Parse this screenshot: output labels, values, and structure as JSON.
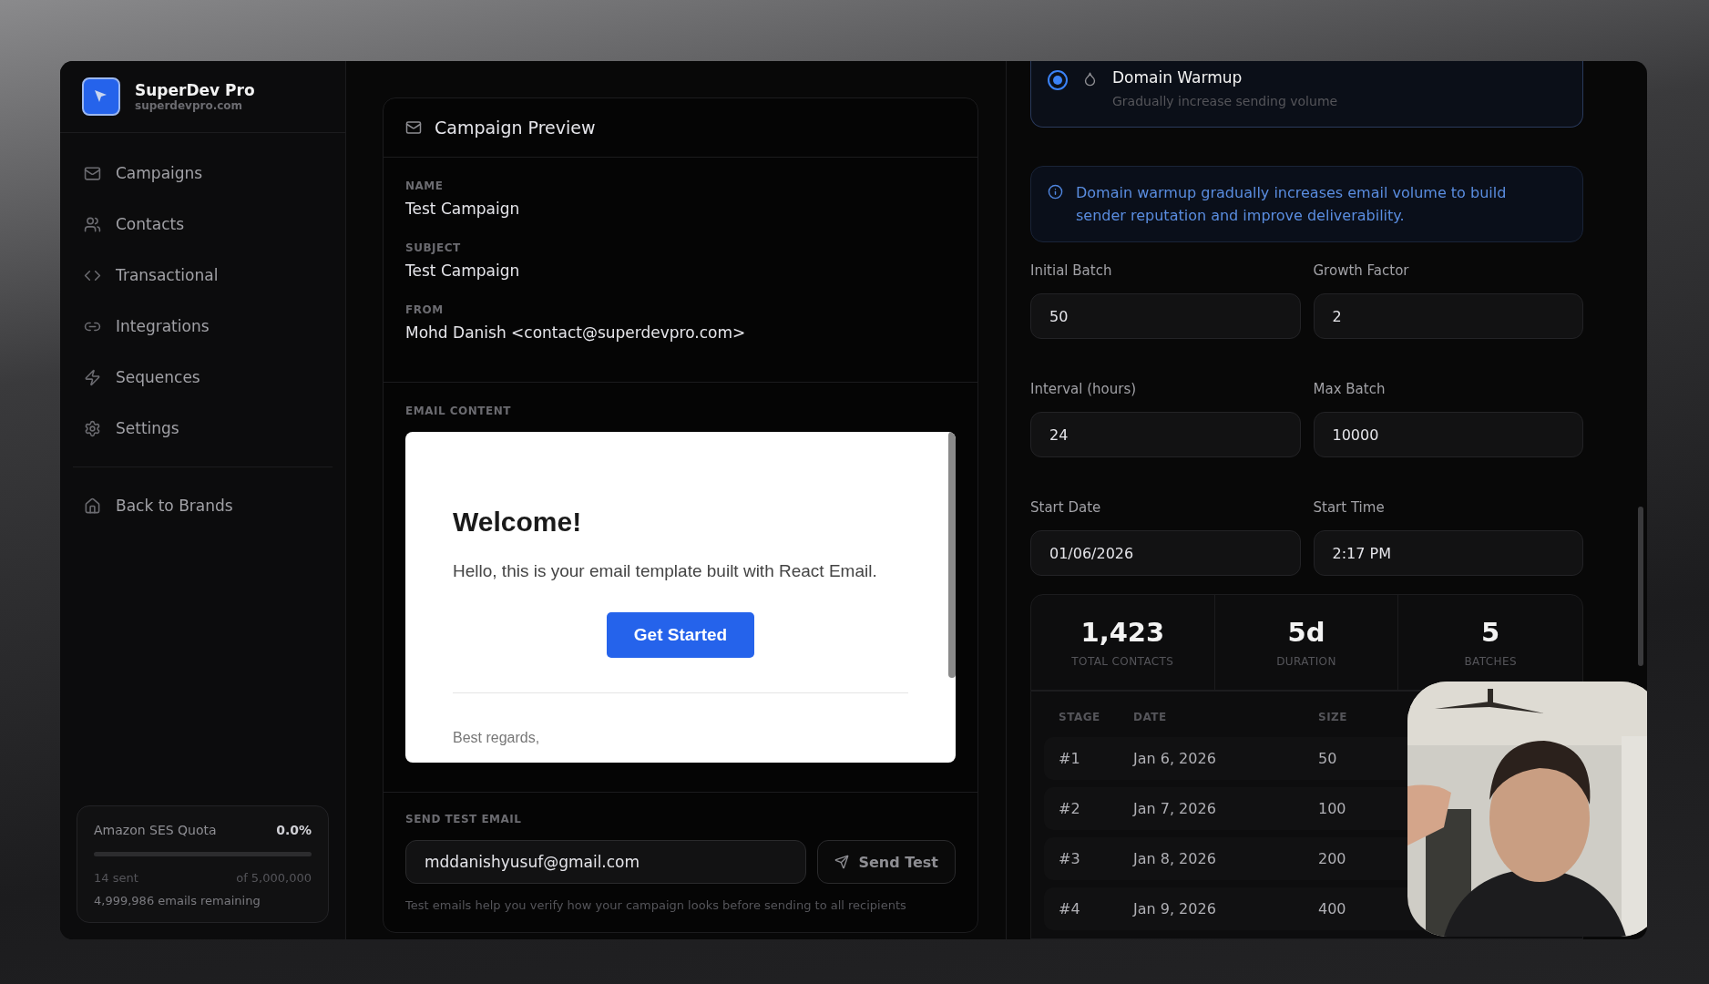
{
  "brand": {
    "name": "SuperDev Pro",
    "domain": "superdevpro.com"
  },
  "nav": [
    {
      "label": "Campaigns"
    },
    {
      "label": "Contacts"
    },
    {
      "label": "Transactional"
    },
    {
      "label": "Integrations"
    },
    {
      "label": "Sequences"
    },
    {
      "label": "Settings"
    }
  ],
  "back_link": "Back to Brands",
  "quota": {
    "title": "Amazon SES Quota",
    "percent": "0.0%",
    "level": 0,
    "sent": "14 sent",
    "total": "of 5,000,000",
    "remaining": "4,999,986 emails remaining"
  },
  "preview": {
    "title": "Campaign Preview",
    "fields": [
      {
        "label": "NAME",
        "value": "Test Campaign"
      },
      {
        "label": "SUBJECT",
        "value": "Test Campaign"
      },
      {
        "label": "FROM",
        "value": "Mohd Danish <contact@superdevpro.com>"
      }
    ],
    "content_label": "EMAIL CONTENT",
    "email": {
      "heading": "Welcome!",
      "body": "Hello, this is your email template built with React Email.",
      "button": "Get Started",
      "signoff": "Best regards,"
    },
    "send_label": "SEND TEST EMAIL",
    "send_value": "mddanishyusuf@gmail.com",
    "send_button": "Send Test",
    "send_hint": "Test emails help you verify how your campaign looks before sending to all recipients"
  },
  "warmup": {
    "option": {
      "title": "Domain Warmup",
      "subtitle": "Gradually increase sending volume",
      "selected": true
    },
    "info": "Domain warmup gradually increases email volume to build sender reputation and improve deliverability.",
    "fields": [
      {
        "label": "Initial Batch",
        "value": "50"
      },
      {
        "label": "Growth Factor",
        "value": "2"
      },
      {
        "label": "Interval (hours)",
        "value": "24"
      },
      {
        "label": "Max Batch",
        "value": "10000"
      },
      {
        "label": "Start Date",
        "value": "01/06/2026"
      },
      {
        "label": "Start Time",
        "value": "2:17 PM"
      }
    ],
    "stats": [
      {
        "value": "1,423",
        "label": "TOTAL CONTACTS"
      },
      {
        "value": "5d",
        "label": "DURATION"
      },
      {
        "value": "5",
        "label": "BATCHES"
      }
    ],
    "columns": [
      "STAGE",
      "DATE",
      "SIZE"
    ],
    "rows": [
      [
        "#1",
        "Jan 6, 2026",
        "50"
      ],
      [
        "#2",
        "Jan 7, 2026",
        "100"
      ],
      [
        "#3",
        "Jan 8, 2026",
        "200"
      ],
      [
        "#4",
        "Jan 9, 2026",
        "400"
      ]
    ]
  }
}
